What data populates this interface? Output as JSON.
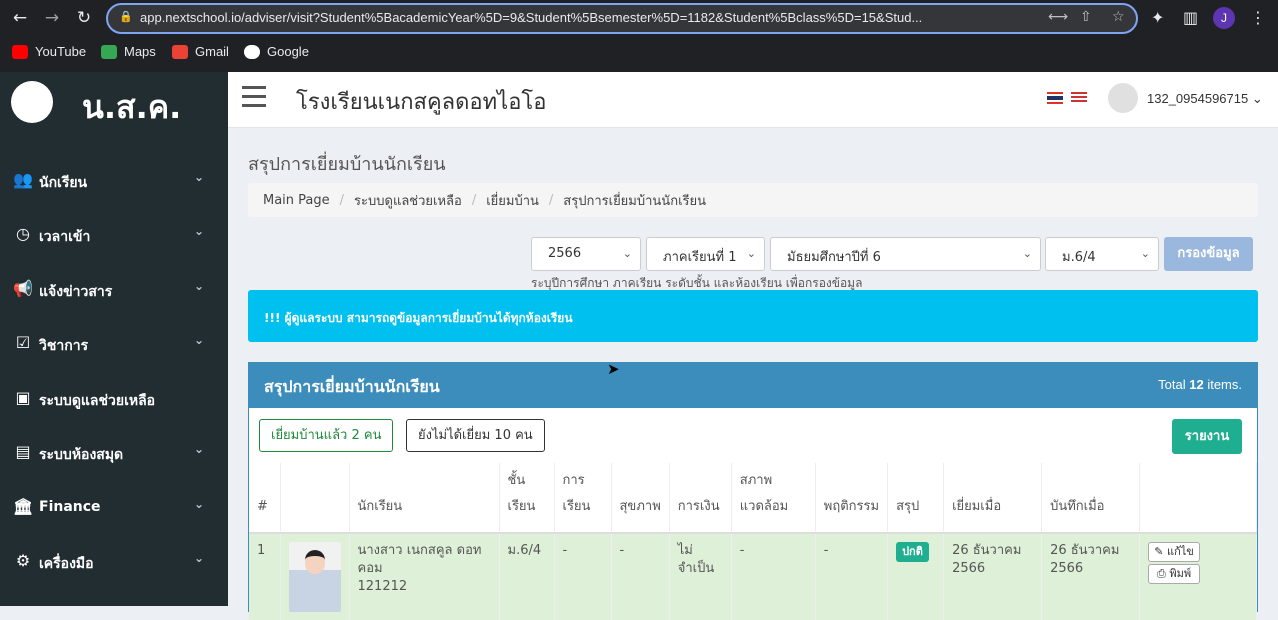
{
  "browser": {
    "url": "app.nextschool.io/adviser/visit?Student%5BacademicYear%5D=9&Student%5Bsemester%5D=1182&Student%5Bclass%5D=15&Stud...",
    "profile_initial": "J",
    "bookmarks": [
      "YouTube",
      "Maps",
      "Gmail",
      "Google"
    ]
  },
  "sidebar": {
    "logo_text": "น.ส.ค.",
    "items": [
      {
        "label": "นักเรียน",
        "icon": "users-icon"
      },
      {
        "label": "เวลาเข้า",
        "icon": "clock-icon"
      },
      {
        "label": "แจ้งข่าวสาร",
        "icon": "megaphone-icon"
      },
      {
        "label": "วิชาการ",
        "icon": "calendar-check-icon"
      },
      {
        "label": "ระบบดูแลช่วยเหลือ",
        "icon": "contact-card-icon"
      },
      {
        "label": "ระบบห้องสมุด",
        "icon": "book-icon"
      },
      {
        "label": "Finance",
        "icon": "bank-icon"
      },
      {
        "label": "เครื่องมือ",
        "icon": "cog-icon"
      }
    ]
  },
  "header": {
    "school_name": "โรงเรียนเนกสคูลดอทไอโอ",
    "username": "132_0954596715"
  },
  "page": {
    "title": "สรุปการเยี่ยมบ้านนักเรียน",
    "breadcrumb": [
      "Main Page",
      "ระบบดูแลช่วยเหลือ",
      "เยี่ยมบ้าน",
      "สรุปการเยี่ยมบ้านนักเรียน"
    ]
  },
  "filters": {
    "year": "2566",
    "semester": "ภาคเรียนที่ 1",
    "level": "มัธยมศึกษาปีที่ 6",
    "room": "ม.6/4",
    "filter_button": "กรองข้อมูล",
    "help_text": "ระบุปีการศึกษา ภาคเรียน ระดับชั้น และห้องเรียน เพื่อกรองข้อมูล"
  },
  "alert": "!!! ผู้ดูแลระบบ สามารถดูข้อมูลการเยี่ยมบ้านได้ทุกห้องเรียน",
  "summary": {
    "title": "สรุปการเยี่ยมบ้านนักเรียน",
    "total_prefix": "Total",
    "total_count": "12",
    "total_suffix": "items.",
    "visited_button": "เยี่ยมบ้านแล้ว 2 คน",
    "not_visited_button": "ยังไม่ได้เยี่ยม 10 คน",
    "report_button": "รายงาน",
    "columns": [
      "#",
      "",
      "นักเรียน",
      "ชั้นเรียน",
      "การเรียน",
      "สุขภาพ",
      "การเงิน",
      "สภาพแวดล้อม",
      "พฤติกรรม",
      "สรุป",
      "เยี่ยมเมื่อ",
      "บันทึกเมื่อ",
      ""
    ],
    "columns_split": {
      "class": [
        "ชั้น",
        "เรียน"
      ],
      "study": [
        "การ",
        "เรียน"
      ],
      "env": [
        "สภาพ",
        "แวดล้อม"
      ]
    },
    "rows": [
      {
        "index": "1",
        "student": "นางสาว เนกสคูล ดอท คอม",
        "student_id": "121212",
        "class": "ม.6/4",
        "study": "-",
        "health": "-",
        "finance": "ไม่จำเป็น",
        "environment": "-",
        "behavior": "-",
        "result": "ปกติ",
        "visited": "26 ธันวาคม 2566",
        "recorded": "26 ธันวาคม 2566",
        "edit": "แก้ไข",
        "print": "พิมพ์"
      }
    ]
  }
}
